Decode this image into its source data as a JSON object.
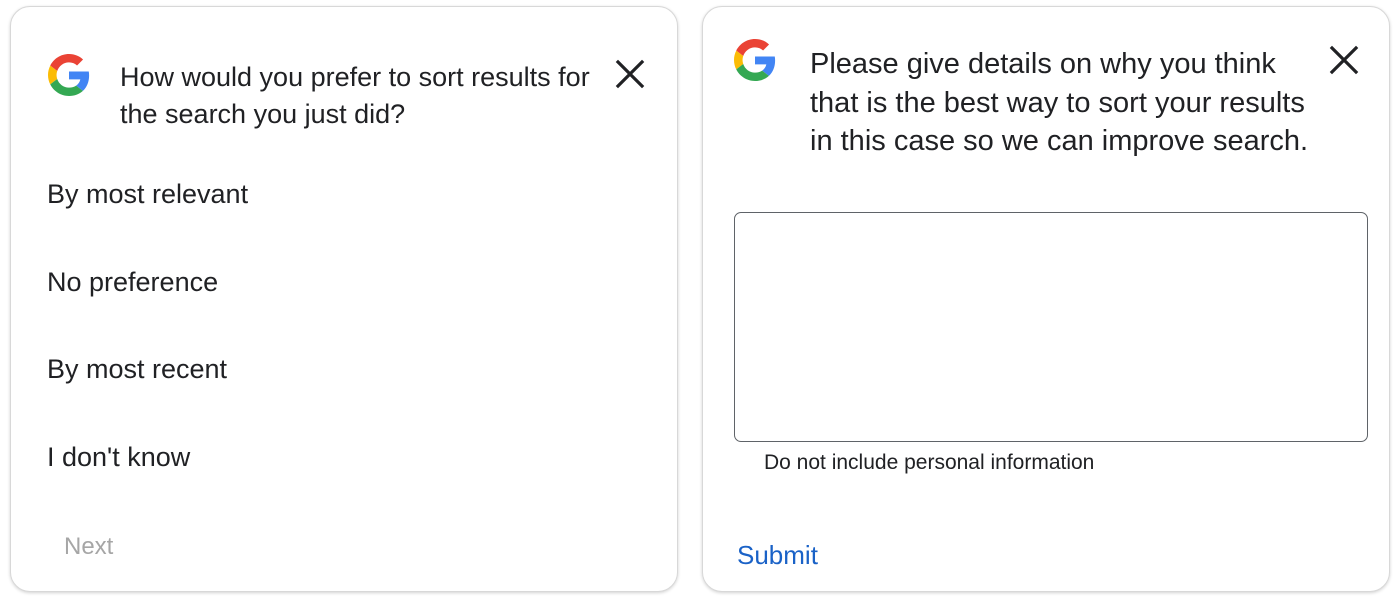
{
  "sort_survey": {
    "question": "How would you prefer to sort results for the search you just did?",
    "options": [
      {
        "label": "By most relevant"
      },
      {
        "label": "No preference"
      },
      {
        "label": "By most recent"
      },
      {
        "label": "I don't know"
      }
    ],
    "next_label": "Next",
    "close_icon": "close-icon",
    "logo_icon": "google-logo-icon"
  },
  "details_survey": {
    "question": "Please give details on why you think that is the best way to sort your results in this case so we can improve search.",
    "feedback_value": "",
    "hint": "Do not include personal information",
    "submit_label": "Submit",
    "close_icon": "close-icon",
    "logo_icon": "google-logo-icon"
  },
  "colors": {
    "text": "#202124",
    "disabled_text": "#a6a6a6",
    "link_blue": "#1a62c7",
    "google_blue": "#4285F4",
    "google_red": "#EA4335",
    "google_yellow": "#FBBC05",
    "google_green": "#34A853"
  }
}
